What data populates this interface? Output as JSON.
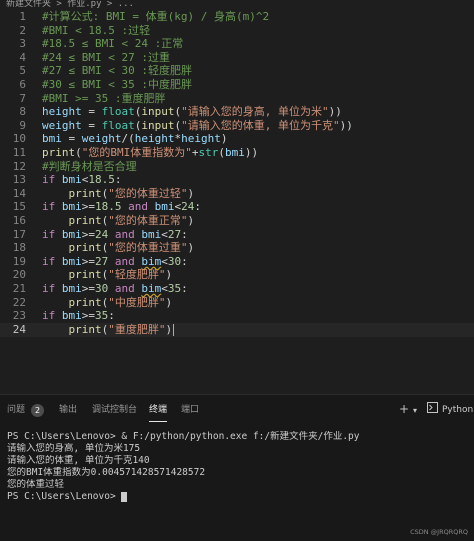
{
  "breadcrumb": "新建文件夹 > 作业.py > ...",
  "editor": {
    "current_line": 24,
    "lines": [
      {
        "n": "1",
        "tokens": [
          {
            "t": "#计算公式: BMI = 体重(kg) / 身高(m)^2",
            "c": "c-comment"
          }
        ]
      },
      {
        "n": "2",
        "tokens": [
          {
            "t": "#BMI < 18.5 :过轻",
            "c": "c-comment"
          }
        ]
      },
      {
        "n": "3",
        "tokens": [
          {
            "t": "#18.5 ≤ BMI < 24 :正常",
            "c": "c-comment"
          }
        ]
      },
      {
        "n": "4",
        "tokens": [
          {
            "t": "#24 ≤ BMI < 27 :过重",
            "c": "c-comment"
          }
        ]
      },
      {
        "n": "5",
        "tokens": [
          {
            "t": "#27 ≤ BMI < 30 :轻度肥胖",
            "c": "c-comment"
          }
        ]
      },
      {
        "n": "6",
        "tokens": [
          {
            "t": "#30 ≤ BMI < 35 :中度肥胖",
            "c": "c-comment"
          }
        ]
      },
      {
        "n": "7",
        "tokens": [
          {
            "t": "#BMI >= 35 :重度肥胖",
            "c": "c-comment"
          }
        ]
      },
      {
        "n": "8",
        "tokens": [
          {
            "t": "height",
            "c": "c-var"
          },
          {
            "t": " = ",
            "c": "c-op"
          },
          {
            "t": "float",
            "c": "c-bi"
          },
          {
            "t": "(",
            "c": "c-op"
          },
          {
            "t": "input",
            "c": "c-fn"
          },
          {
            "t": "(",
            "c": "c-op"
          },
          {
            "t": "\"请输入您的身高, 单位为米\"",
            "c": "c-str"
          },
          {
            "t": "))",
            "c": "c-op"
          }
        ]
      },
      {
        "n": "9",
        "tokens": [
          {
            "t": "weight",
            "c": "c-var"
          },
          {
            "t": " = ",
            "c": "c-op"
          },
          {
            "t": "float",
            "c": "c-bi"
          },
          {
            "t": "(",
            "c": "c-op"
          },
          {
            "t": "input",
            "c": "c-fn"
          },
          {
            "t": "(",
            "c": "c-op"
          },
          {
            "t": "\"请输入您的体重, 单位为千克\"",
            "c": "c-str"
          },
          {
            "t": "))",
            "c": "c-op"
          }
        ]
      },
      {
        "n": "10",
        "tokens": [
          {
            "t": "bmi",
            "c": "c-var"
          },
          {
            "t": " = ",
            "c": "c-op"
          },
          {
            "t": "weight",
            "c": "c-var"
          },
          {
            "t": "/(",
            "c": "c-op"
          },
          {
            "t": "height",
            "c": "c-var"
          },
          {
            "t": "*",
            "c": "c-op"
          },
          {
            "t": "height",
            "c": "c-var"
          },
          {
            "t": ")",
            "c": "c-op"
          }
        ]
      },
      {
        "n": "11",
        "tokens": [
          {
            "t": "print",
            "c": "c-fn"
          },
          {
            "t": "(",
            "c": "c-op"
          },
          {
            "t": "\"您的BMI体重指数为\"",
            "c": "c-str"
          },
          {
            "t": "+",
            "c": "c-op"
          },
          {
            "t": "str",
            "c": "c-bi"
          },
          {
            "t": "(",
            "c": "c-op"
          },
          {
            "t": "bmi",
            "c": "c-var"
          },
          {
            "t": "))",
            "c": "c-op"
          }
        ]
      },
      {
        "n": "12",
        "tokens": [
          {
            "t": "#判断身材是否合理",
            "c": "c-comment"
          }
        ]
      },
      {
        "n": "13",
        "tokens": [
          {
            "t": "if",
            "c": "c-kw"
          },
          {
            "t": " ",
            "c": "c-op"
          },
          {
            "t": "bmi",
            "c": "c-var"
          },
          {
            "t": "<",
            "c": "c-op"
          },
          {
            "t": "18.5",
            "c": "c-num"
          },
          {
            "t": ":",
            "c": "c-op"
          }
        ]
      },
      {
        "n": "14",
        "tokens": [
          {
            "t": "    ",
            "c": "c-op"
          },
          {
            "t": "print",
            "c": "c-fn"
          },
          {
            "t": "(",
            "c": "c-op"
          },
          {
            "t": "\"您的体重过轻\"",
            "c": "c-str"
          },
          {
            "t": ")",
            "c": "c-op"
          }
        ]
      },
      {
        "n": "15",
        "tokens": [
          {
            "t": "if",
            "c": "c-kw"
          },
          {
            "t": " ",
            "c": "c-op"
          },
          {
            "t": "bmi",
            "c": "c-var"
          },
          {
            "t": ">=",
            "c": "c-op"
          },
          {
            "t": "18.5",
            "c": "c-num"
          },
          {
            "t": " and ",
            "c": "c-kw"
          },
          {
            "t": "bmi",
            "c": "c-var"
          },
          {
            "t": "<",
            "c": "c-op"
          },
          {
            "t": "24",
            "c": "c-num"
          },
          {
            "t": ":",
            "c": "c-op"
          }
        ]
      },
      {
        "n": "16",
        "tokens": [
          {
            "t": "    ",
            "c": "c-op"
          },
          {
            "t": "print",
            "c": "c-fn"
          },
          {
            "t": "(",
            "c": "c-op"
          },
          {
            "t": "\"您的体重正常\"",
            "c": "c-str"
          },
          {
            "t": ")",
            "c": "c-op"
          }
        ]
      },
      {
        "n": "17",
        "tokens": [
          {
            "t": "if",
            "c": "c-kw"
          },
          {
            "t": " ",
            "c": "c-op"
          },
          {
            "t": "bmi",
            "c": "c-var"
          },
          {
            "t": ">=",
            "c": "c-op"
          },
          {
            "t": "24",
            "c": "c-num"
          },
          {
            "t": " and ",
            "c": "c-kw"
          },
          {
            "t": "bmi",
            "c": "c-var"
          },
          {
            "t": "<",
            "c": "c-op"
          },
          {
            "t": "27",
            "c": "c-num"
          },
          {
            "t": ":",
            "c": "c-op"
          }
        ]
      },
      {
        "n": "18",
        "tokens": [
          {
            "t": "    ",
            "c": "c-op"
          },
          {
            "t": "print",
            "c": "c-fn"
          },
          {
            "t": "(",
            "c": "c-op"
          },
          {
            "t": "\"您的体重过重\"",
            "c": "c-str"
          },
          {
            "t": ")",
            "c": "c-op"
          }
        ]
      },
      {
        "n": "19",
        "tokens": [
          {
            "t": "if",
            "c": "c-kw"
          },
          {
            "t": " ",
            "c": "c-op"
          },
          {
            "t": "bmi",
            "c": "c-var"
          },
          {
            "t": ">=",
            "c": "c-op"
          },
          {
            "t": "27",
            "c": "c-num"
          },
          {
            "t": " and ",
            "c": "c-kw"
          },
          {
            "t": "bim",
            "c": "c-var underline"
          },
          {
            "t": "<",
            "c": "c-op"
          },
          {
            "t": "30",
            "c": "c-num"
          },
          {
            "t": ":",
            "c": "c-op"
          }
        ]
      },
      {
        "n": "20",
        "tokens": [
          {
            "t": "    ",
            "c": "c-op"
          },
          {
            "t": "print",
            "c": "c-fn"
          },
          {
            "t": "(",
            "c": "c-op"
          },
          {
            "t": "\"轻度肥胖\"",
            "c": "c-str"
          },
          {
            "t": ")",
            "c": "c-op"
          }
        ]
      },
      {
        "n": "21",
        "tokens": [
          {
            "t": "if",
            "c": "c-kw"
          },
          {
            "t": " ",
            "c": "c-op"
          },
          {
            "t": "bmi",
            "c": "c-var"
          },
          {
            "t": ">=",
            "c": "c-op"
          },
          {
            "t": "30",
            "c": "c-num"
          },
          {
            "t": " and ",
            "c": "c-kw"
          },
          {
            "t": "bim",
            "c": "c-var underline"
          },
          {
            "t": "<",
            "c": "c-op"
          },
          {
            "t": "35",
            "c": "c-num"
          },
          {
            "t": ":",
            "c": "c-op"
          }
        ]
      },
      {
        "n": "22",
        "tokens": [
          {
            "t": "    ",
            "c": "c-op"
          },
          {
            "t": "print",
            "c": "c-fn"
          },
          {
            "t": "(",
            "c": "c-op"
          },
          {
            "t": "\"中度肥胖\"",
            "c": "c-str"
          },
          {
            "t": ")",
            "c": "c-op"
          }
        ]
      },
      {
        "n": "23",
        "tokens": [
          {
            "t": "if",
            "c": "c-kw"
          },
          {
            "t": " ",
            "c": "c-op"
          },
          {
            "t": "bmi",
            "c": "c-var"
          },
          {
            "t": ">=",
            "c": "c-op"
          },
          {
            "t": "35",
            "c": "c-num"
          },
          {
            "t": ":",
            "c": "c-op"
          }
        ]
      },
      {
        "n": "24",
        "tokens": [
          {
            "t": "    ",
            "c": "c-op"
          },
          {
            "t": "print",
            "c": "c-fn"
          },
          {
            "t": "(",
            "c": "c-op"
          },
          {
            "t": "\"重度肥胖\"",
            "c": "c-str"
          },
          {
            "t": ")",
            "c": "c-op"
          }
        ]
      }
    ]
  },
  "panel": {
    "tabs": {
      "problems": "问题",
      "problems_count": "2",
      "output": "输出",
      "debug_console": "调试控制台",
      "terminal": "终端",
      "ports": "端口"
    },
    "add_icon": "plus-icon",
    "split_icon": "chevron-down-icon",
    "terminal_icon": "terminal-icon",
    "python_label": "Python"
  },
  "terminal": {
    "lines": [
      "PS C:\\Users\\Lenovo> & F:/python/python.exe f:/新建文件夹/作业.py",
      "请输入您的身高, 单位为米175",
      "请输入您的体重, 单位为千克140",
      "您的BMI体重指数为0.004571428571428572",
      "您的体重过轻",
      "PS C:\\Users\\Lenovo> "
    ]
  },
  "watermark": "CSDN @JRQRQRQ",
  "colors": {
    "background": "#1e1e1e",
    "panel": "#181818",
    "comment": "#6a9955",
    "keyword": "#c586c0",
    "string": "#ce9178",
    "function": "#dcdcaa",
    "variable": "#9cdcfe",
    "number": "#b5cea8"
  }
}
